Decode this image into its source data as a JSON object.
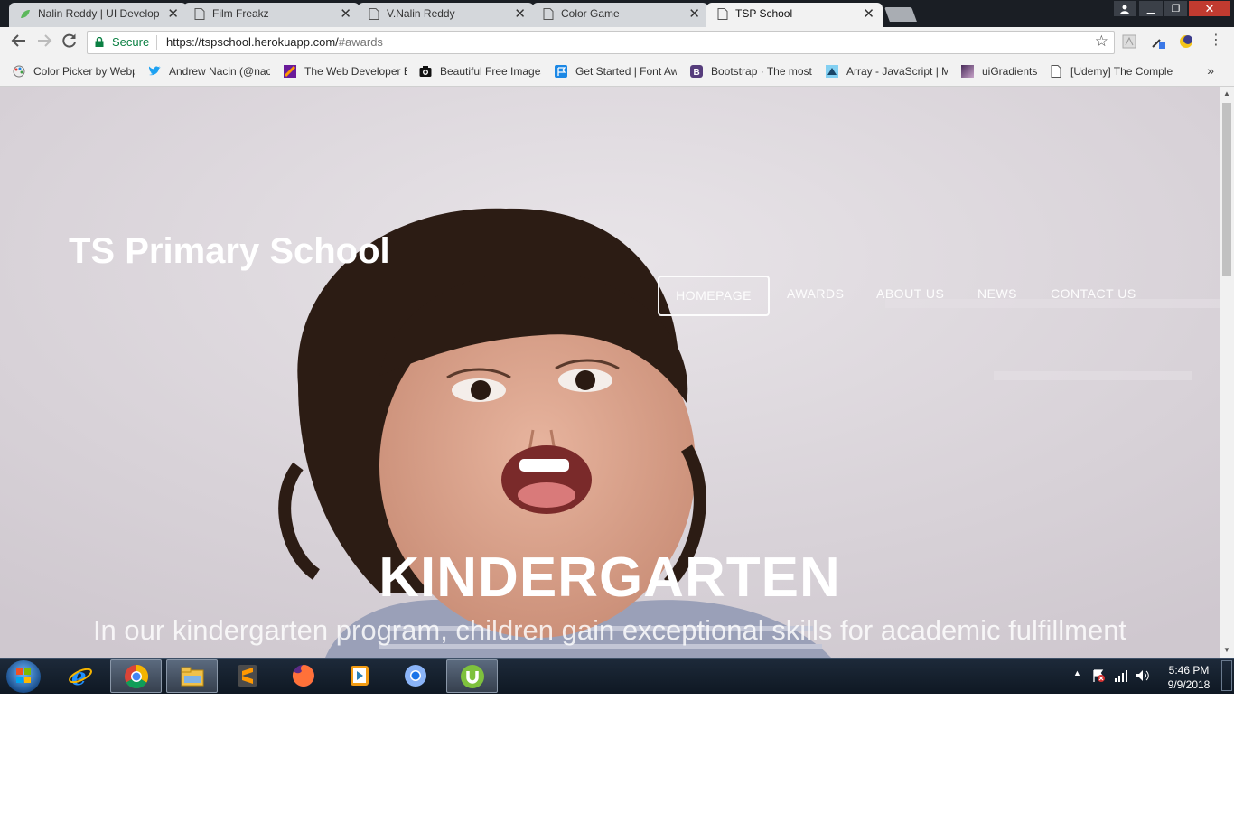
{
  "browser": {
    "tabs": [
      {
        "title": "Nalin Reddy | UI Develop",
        "active": false
      },
      {
        "title": "Film Freakz",
        "active": false
      },
      {
        "title": "V.Nalin Reddy",
        "active": false
      },
      {
        "title": "Color Game",
        "active": false
      },
      {
        "title": "TSP School",
        "active": true
      }
    ],
    "close_glyph": "✕",
    "window_controls": {
      "minimize": "▁",
      "maximize": "❐",
      "close": "✕"
    },
    "secure_label": "Secure",
    "url_base": "https://tspschool.herokuapp.com/",
    "url_path": "#awards",
    "bookmarks": [
      {
        "label": "Color Picker by Webp",
        "icon": "palette-icon"
      },
      {
        "label": "Andrew Nacin (@nac",
        "icon": "twitter-icon"
      },
      {
        "label": "The Web Developer E",
        "icon": "course-icon"
      },
      {
        "label": "Beautiful Free Images",
        "icon": "camera-icon"
      },
      {
        "label": "Get Started | Font Aw",
        "icon": "flag-icon"
      },
      {
        "label": "Bootstrap · The most",
        "icon": "bootstrap-icon"
      },
      {
        "label": "Array - JavaScript | M",
        "icon": "mdn-icon"
      },
      {
        "label": "uiGradients",
        "icon": "gradient-icon"
      },
      {
        "label": "[Udemy] The Comple",
        "icon": "page-icon"
      }
    ],
    "bookmarks_more": "»"
  },
  "page": {
    "school_title": "TS Primary School",
    "nav": [
      {
        "label": "HOMEPAGE",
        "active": true
      },
      {
        "label": "AWARDS",
        "active": false
      },
      {
        "label": "ABOUT US",
        "active": false
      },
      {
        "label": "NEWS",
        "active": false
      },
      {
        "label": "CONTACT US",
        "active": false
      }
    ],
    "hero_title": "KINDERGARTEN",
    "hero_subtitle": "In our kindergarten program, children gain exceptional skills for academic fulfillment"
  },
  "taskbar": {
    "apps": [
      {
        "name": "internet-explorer-icon",
        "open": false
      },
      {
        "name": "chrome-icon",
        "open": true
      },
      {
        "name": "file-explorer-icon",
        "open": true
      },
      {
        "name": "sublime-text-icon",
        "open": false
      },
      {
        "name": "firefox-icon",
        "open": false
      },
      {
        "name": "media-player-icon",
        "open": false
      },
      {
        "name": "chromium-icon",
        "open": false
      },
      {
        "name": "utorrent-icon",
        "open": true
      }
    ],
    "tray_up": "▲",
    "time": "5:46 PM",
    "date": "9/9/2018"
  },
  "colors": {
    "secure_green": "#0b8043",
    "tabstrip_bg": "#1a1e24",
    "hero_text": "#ffffff"
  }
}
